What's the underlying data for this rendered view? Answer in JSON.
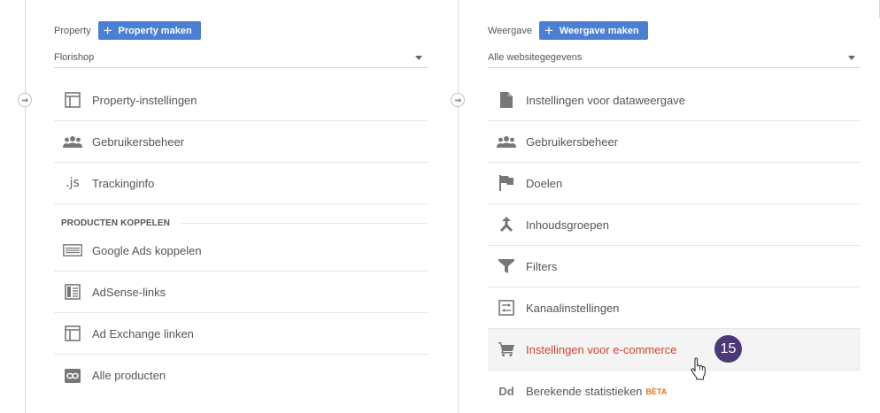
{
  "property": {
    "label": "Property",
    "make_button": "Property maken",
    "selected": "Florishop",
    "items": [
      {
        "label": "Property-instellingen",
        "icon": "panel-icon"
      },
      {
        "label": "Gebruikersbeheer",
        "icon": "users-icon"
      },
      {
        "label": "Trackinginfo",
        "icon": "js-icon",
        "icon_text": ".js"
      }
    ],
    "section_title": "PRODUCTEN KOPPELEN",
    "linked": [
      {
        "label": "Google Ads koppelen",
        "icon": "ads-icon"
      },
      {
        "label": "AdSense-links",
        "icon": "adsense-icon"
      },
      {
        "label": "Ad Exchange linken",
        "icon": "adexchange-icon"
      },
      {
        "label": "Alle producten",
        "icon": "link-icon"
      }
    ]
  },
  "view": {
    "label": "Weergave",
    "make_button": "Weergave maken",
    "selected": "Alle websitegegevens",
    "items": [
      {
        "label": "Instellingen voor dataweergave",
        "icon": "document-icon"
      },
      {
        "label": "Gebruikersbeheer",
        "icon": "users-icon"
      },
      {
        "label": "Doelen",
        "icon": "flag-icon"
      },
      {
        "label": "Inhoudsgroepen",
        "icon": "merge-icon"
      },
      {
        "label": "Filters",
        "icon": "filter-icon"
      },
      {
        "label": "Kanaalinstellingen",
        "icon": "channel-icon"
      },
      {
        "label": "Instellingen voor e-commerce",
        "icon": "cart-icon"
      },
      {
        "label": "Berekende statistieken",
        "icon": "dd-icon",
        "icon_text": "Dd",
        "tag": "BÈTA"
      }
    ]
  },
  "annotation": {
    "badge": "15"
  },
  "colors": {
    "button_bg": "#4a7fd4",
    "active_text": "#d04433",
    "beta": "#e8710a",
    "badge_bg": "#4b3a77"
  }
}
